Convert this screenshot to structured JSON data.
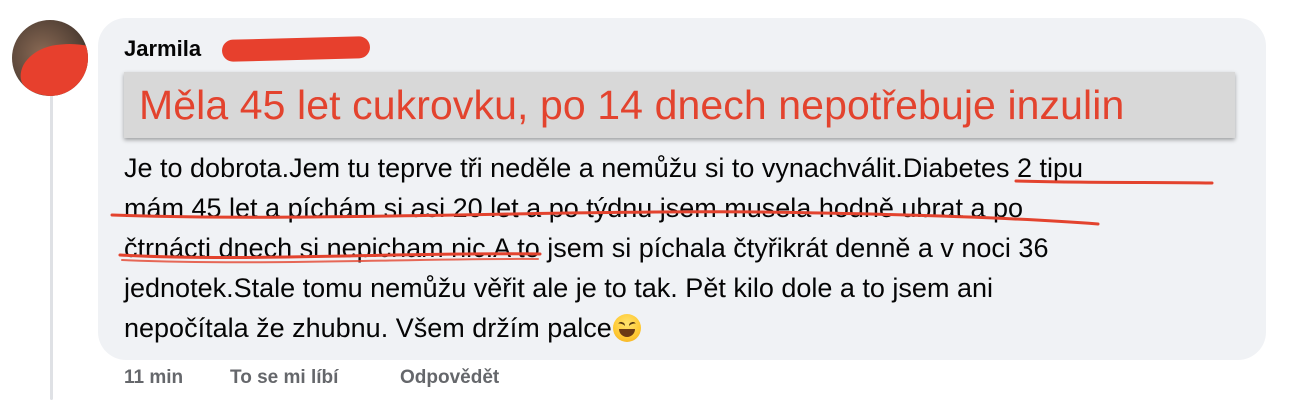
{
  "comment": {
    "author": "Jarmila",
    "headline": "Měla 45 let cukrovku, po 14 dnech nepotřebuje inzulin",
    "body_lines": [
      "Je to dobrota.Jem tu teprve tři neděle a nemůžu si to vynachválit.Diabetes 2 tipu",
      "mám 45 let a píchám si asi 20 let a po týdnu jsem musela hodně ubrat a po",
      "čtrnácti dnech si nepicham nic.A to jsem si píchala čtyřikrát denně a v noci 36",
      "jednotek.Stale tomu nemůžu věřit ale je to tak. Pět kilo dole a to jsem ani",
      "nepočítala že zhubnu. Všem držím palce"
    ],
    "emoji": "grinning-squinting-face-icon",
    "annotation_color": "#e3432e"
  },
  "actions": {
    "time": "11 min",
    "like": "To se mi líbí",
    "reply": "Odpovědět"
  }
}
